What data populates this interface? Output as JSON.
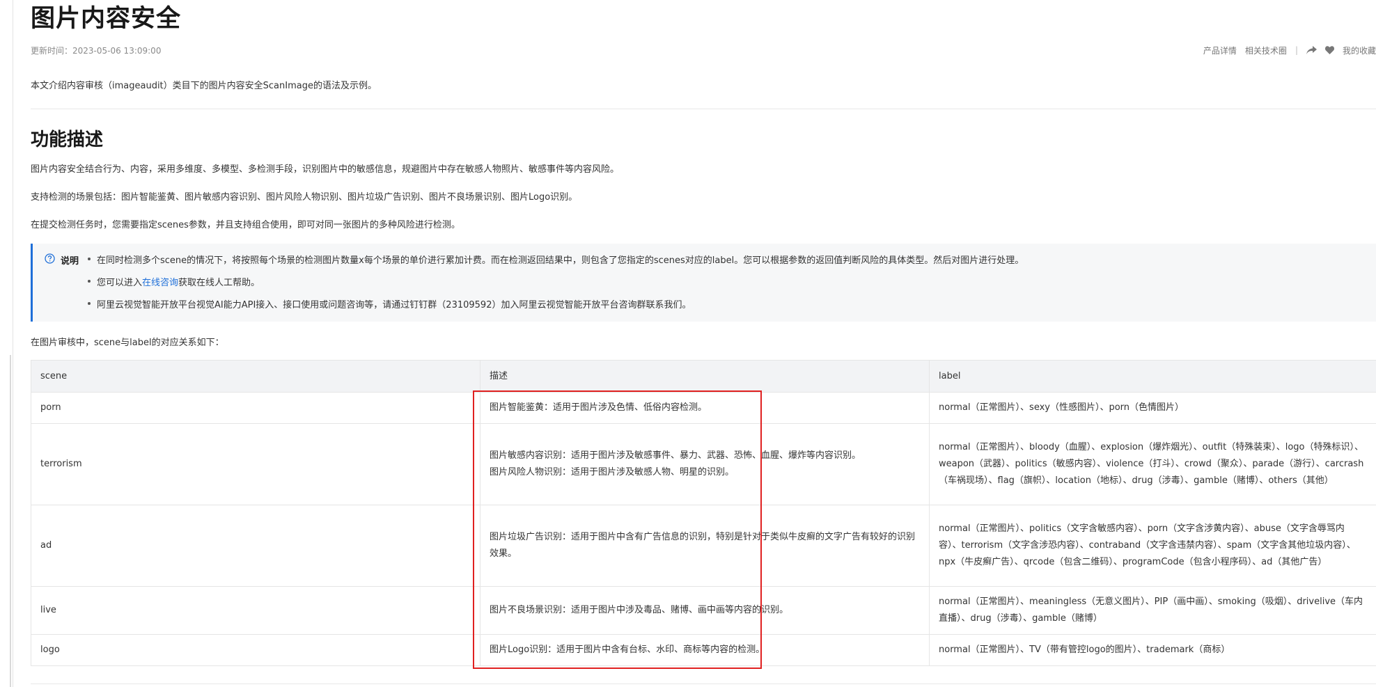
{
  "page": {
    "title": "图片内容安全",
    "updated": "更新时间：2023-05-06 13:09:00"
  },
  "toolbar": {
    "product_detail": "产品详情",
    "related_tech": "相关技术圈",
    "separator": "|",
    "favorite": "我的收藏",
    "icons": [
      "share-icon",
      "heart-icon"
    ]
  },
  "intro": "本文介绍内容审核（imageaudit）类目下的图片内容安全ScanImage的语法及示例。",
  "section": {
    "title": "功能描述",
    "paragraphs": [
      "图片内容安全结合行为、内容，采用多维度、多模型、多检测手段，识别图片中的敏感信息，规避图片中存在敏感人物照片、敏感事件等内容风险。",
      "支持检测的场景包括：图片智能鉴黄、图片敏感内容识别、图片风险人物识别、图片垃圾广告识别、图片不良场景识别、图片Logo识别。",
      "在提交检测任务时，您需要指定scenes参数，并且支持组合使用，即可对同一张图片的多种风险进行检测。"
    ]
  },
  "note": {
    "label": "说明",
    "items": [
      "在同时检测多个scene的情况下，将按照每个场景的检测图片数量x每个场景的单价进行累加计费。而在检测返回结果中，则包含了您指定的scenes对应的label。您可以根据参数的返回值判断风险的具体类型。然后对图片进行处理。",
      "获取在线人工帮助。",
      "阿里云视觉智能开放平台视觉AI能力API接入、接口使用或问题咨询等，请通过钉钉群（23109592）加入阿里云视觉智能开放平台咨询群联系我们。"
    ],
    "item2_prefix": "您可以进入",
    "item2_link": "在线咨询",
    "accent_color": "#1f6fd8"
  },
  "table": {
    "intro": "在图片审核中，scene与label的对应关系如下：",
    "headers": [
      "scene",
      "描述",
      "label"
    ],
    "rows": [
      {
        "scene": "porn",
        "desc": [
          "图片智能鉴黄：适用于图片涉及色情、低俗内容检测。"
        ],
        "label": "normal（正常图片）、sexy（性感图片）、porn（色情图片）"
      },
      {
        "scene": "terrorism",
        "desc": [
          "图片敏感内容识别：适用于图片涉及敏感事件、暴力、武器、恐怖、血腥、爆炸等内容识别。",
          "图片风险人物识别：适用于图片涉及敏感人物、明星的识别。"
        ],
        "label": "normal（正常图片）、bloody（血腥）、explosion（爆炸烟光）、outfit（特殊装束）、logo（特殊标识）、weapon（武器）、politics（敏感内容）、violence（打斗）、crowd（聚众）、parade（游行）、carcrash（车祸现场）、flag（旗帜）、location（地标）、drug（涉毒）、gamble（赌博）、others（其他）"
      },
      {
        "scene": "ad",
        "desc": [
          "图片垃圾广告识别：适用于图片中含有广告信息的识别，特别是针对于类似牛皮癣的文字广告有较好的识别效果。"
        ],
        "label": "normal（正常图片）、politics（文字含敏感内容）、porn（文字含涉黄内容）、abuse（文字含辱骂内容）、terrorism（文字含涉恐内容）、contraband（文字含违禁内容）、spam（文字含其他垃圾内容）、npx（牛皮癣广告）、qrcode（包含二维码）、programCode（包含小程序码）、ad（其他广告）"
      },
      {
        "scene": "live",
        "desc": [
          "图片不良场景识别：适用于图片中涉及毒品、赌博、画中画等内容的识别。"
        ],
        "label": "normal（正常图片）、meaningless（无意义图片）、PIP（画中画）、smoking（吸烟）、drivelive（车内直播）、drug（涉毒）、gamble（赌博）"
      },
      {
        "scene": "logo",
        "desc": [
          "图片Logo识别：适用于图片中含有台标、水印、商标等内容的检测。"
        ],
        "label": "normal（正常图片）、TV（带有管控logo的图片）、trademark（商标）"
      }
    ]
  },
  "highlight_color": "#e02020"
}
